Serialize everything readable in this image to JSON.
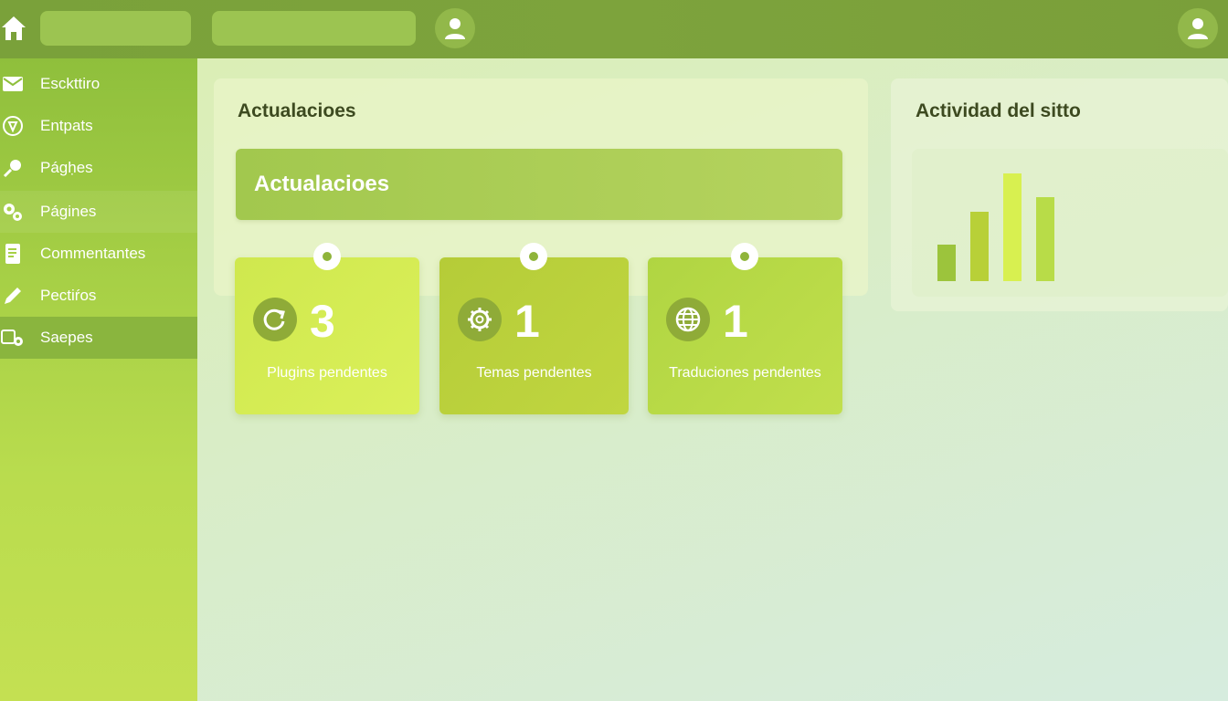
{
  "topbar": {
    "home_icon": "home-icon",
    "user_icon": "user-icon"
  },
  "sidebar": {
    "items": [
      {
        "label": "Esckttiro",
        "icon": "envelope-icon"
      },
      {
        "label": "Entpats",
        "icon": "pin-circle-icon"
      },
      {
        "label": "Págḥes",
        "icon": "pushpin-icon"
      },
      {
        "label": "Págines",
        "icon": "gears-icon"
      },
      {
        "label": "Commentantes",
        "icon": "document-icon"
      },
      {
        "label": "Pectiŕos",
        "icon": "pencil-icon"
      },
      {
        "label": "Saepes",
        "icon": "settings-icon"
      }
    ]
  },
  "updates": {
    "title": "Actualacioes",
    "banner": "Actualacioes",
    "cards": [
      {
        "count": "3",
        "label": "Plugins pendentes",
        "icon": "refresh-icon"
      },
      {
        "count": "1",
        "label": "Temas pendentes",
        "icon": "gear-icon"
      },
      {
        "count": "1",
        "label": "Traduciones pendentes",
        "icon": "globe-icon"
      }
    ]
  },
  "activity": {
    "title": "Actividad del sitto"
  },
  "chart_data": {
    "type": "bar",
    "title": "",
    "categories": [
      "",
      "",
      "",
      ""
    ],
    "values": [
      40,
      76,
      118,
      92
    ],
    "colors": [
      "#9cc43c",
      "#b8d038",
      "#d8f050",
      "#b8dc48"
    ],
    "ylim": [
      0,
      128
    ],
    "grid": false
  },
  "colors": {
    "topbar": "#7aa13a",
    "sidebar_active": "#8ab53e",
    "title_text": "#3d4a20"
  }
}
